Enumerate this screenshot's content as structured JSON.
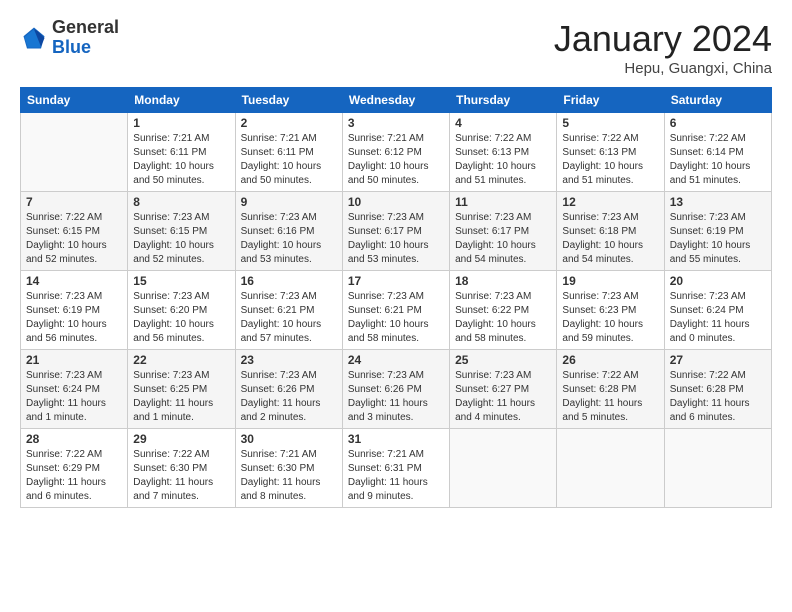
{
  "header": {
    "logo_general": "General",
    "logo_blue": "Blue",
    "title": "January 2024",
    "location": "Hepu, Guangxi, China"
  },
  "weekdays": [
    "Sunday",
    "Monday",
    "Tuesday",
    "Wednesday",
    "Thursday",
    "Friday",
    "Saturday"
  ],
  "weeks": [
    [
      {
        "day": "",
        "info": ""
      },
      {
        "day": "1",
        "info": "Sunrise: 7:21 AM\nSunset: 6:11 PM\nDaylight: 10 hours\nand 50 minutes."
      },
      {
        "day": "2",
        "info": "Sunrise: 7:21 AM\nSunset: 6:11 PM\nDaylight: 10 hours\nand 50 minutes."
      },
      {
        "day": "3",
        "info": "Sunrise: 7:21 AM\nSunset: 6:12 PM\nDaylight: 10 hours\nand 50 minutes."
      },
      {
        "day": "4",
        "info": "Sunrise: 7:22 AM\nSunset: 6:13 PM\nDaylight: 10 hours\nand 51 minutes."
      },
      {
        "day": "5",
        "info": "Sunrise: 7:22 AM\nSunset: 6:13 PM\nDaylight: 10 hours\nand 51 minutes."
      },
      {
        "day": "6",
        "info": "Sunrise: 7:22 AM\nSunset: 6:14 PM\nDaylight: 10 hours\nand 51 minutes."
      }
    ],
    [
      {
        "day": "7",
        "info": "Sunrise: 7:22 AM\nSunset: 6:15 PM\nDaylight: 10 hours\nand 52 minutes."
      },
      {
        "day": "8",
        "info": "Sunrise: 7:23 AM\nSunset: 6:15 PM\nDaylight: 10 hours\nand 52 minutes."
      },
      {
        "day": "9",
        "info": "Sunrise: 7:23 AM\nSunset: 6:16 PM\nDaylight: 10 hours\nand 53 minutes."
      },
      {
        "day": "10",
        "info": "Sunrise: 7:23 AM\nSunset: 6:17 PM\nDaylight: 10 hours\nand 53 minutes."
      },
      {
        "day": "11",
        "info": "Sunrise: 7:23 AM\nSunset: 6:17 PM\nDaylight: 10 hours\nand 54 minutes."
      },
      {
        "day": "12",
        "info": "Sunrise: 7:23 AM\nSunset: 6:18 PM\nDaylight: 10 hours\nand 54 minutes."
      },
      {
        "day": "13",
        "info": "Sunrise: 7:23 AM\nSunset: 6:19 PM\nDaylight: 10 hours\nand 55 minutes."
      }
    ],
    [
      {
        "day": "14",
        "info": "Sunrise: 7:23 AM\nSunset: 6:19 PM\nDaylight: 10 hours\nand 56 minutes."
      },
      {
        "day": "15",
        "info": "Sunrise: 7:23 AM\nSunset: 6:20 PM\nDaylight: 10 hours\nand 56 minutes."
      },
      {
        "day": "16",
        "info": "Sunrise: 7:23 AM\nSunset: 6:21 PM\nDaylight: 10 hours\nand 57 minutes."
      },
      {
        "day": "17",
        "info": "Sunrise: 7:23 AM\nSunset: 6:21 PM\nDaylight: 10 hours\nand 58 minutes."
      },
      {
        "day": "18",
        "info": "Sunrise: 7:23 AM\nSunset: 6:22 PM\nDaylight: 10 hours\nand 58 minutes."
      },
      {
        "day": "19",
        "info": "Sunrise: 7:23 AM\nSunset: 6:23 PM\nDaylight: 10 hours\nand 59 minutes."
      },
      {
        "day": "20",
        "info": "Sunrise: 7:23 AM\nSunset: 6:24 PM\nDaylight: 11 hours\nand 0 minutes."
      }
    ],
    [
      {
        "day": "21",
        "info": "Sunrise: 7:23 AM\nSunset: 6:24 PM\nDaylight: 11 hours\nand 1 minute."
      },
      {
        "day": "22",
        "info": "Sunrise: 7:23 AM\nSunset: 6:25 PM\nDaylight: 11 hours\nand 1 minute."
      },
      {
        "day": "23",
        "info": "Sunrise: 7:23 AM\nSunset: 6:26 PM\nDaylight: 11 hours\nand 2 minutes."
      },
      {
        "day": "24",
        "info": "Sunrise: 7:23 AM\nSunset: 6:26 PM\nDaylight: 11 hours\nand 3 minutes."
      },
      {
        "day": "25",
        "info": "Sunrise: 7:23 AM\nSunset: 6:27 PM\nDaylight: 11 hours\nand 4 minutes."
      },
      {
        "day": "26",
        "info": "Sunrise: 7:22 AM\nSunset: 6:28 PM\nDaylight: 11 hours\nand 5 minutes."
      },
      {
        "day": "27",
        "info": "Sunrise: 7:22 AM\nSunset: 6:28 PM\nDaylight: 11 hours\nand 6 minutes."
      }
    ],
    [
      {
        "day": "28",
        "info": "Sunrise: 7:22 AM\nSunset: 6:29 PM\nDaylight: 11 hours\nand 6 minutes."
      },
      {
        "day": "29",
        "info": "Sunrise: 7:22 AM\nSunset: 6:30 PM\nDaylight: 11 hours\nand 7 minutes."
      },
      {
        "day": "30",
        "info": "Sunrise: 7:21 AM\nSunset: 6:30 PM\nDaylight: 11 hours\nand 8 minutes."
      },
      {
        "day": "31",
        "info": "Sunrise: 7:21 AM\nSunset: 6:31 PM\nDaylight: 11 hours\nand 9 minutes."
      },
      {
        "day": "",
        "info": ""
      },
      {
        "day": "",
        "info": ""
      },
      {
        "day": "",
        "info": ""
      }
    ]
  ]
}
